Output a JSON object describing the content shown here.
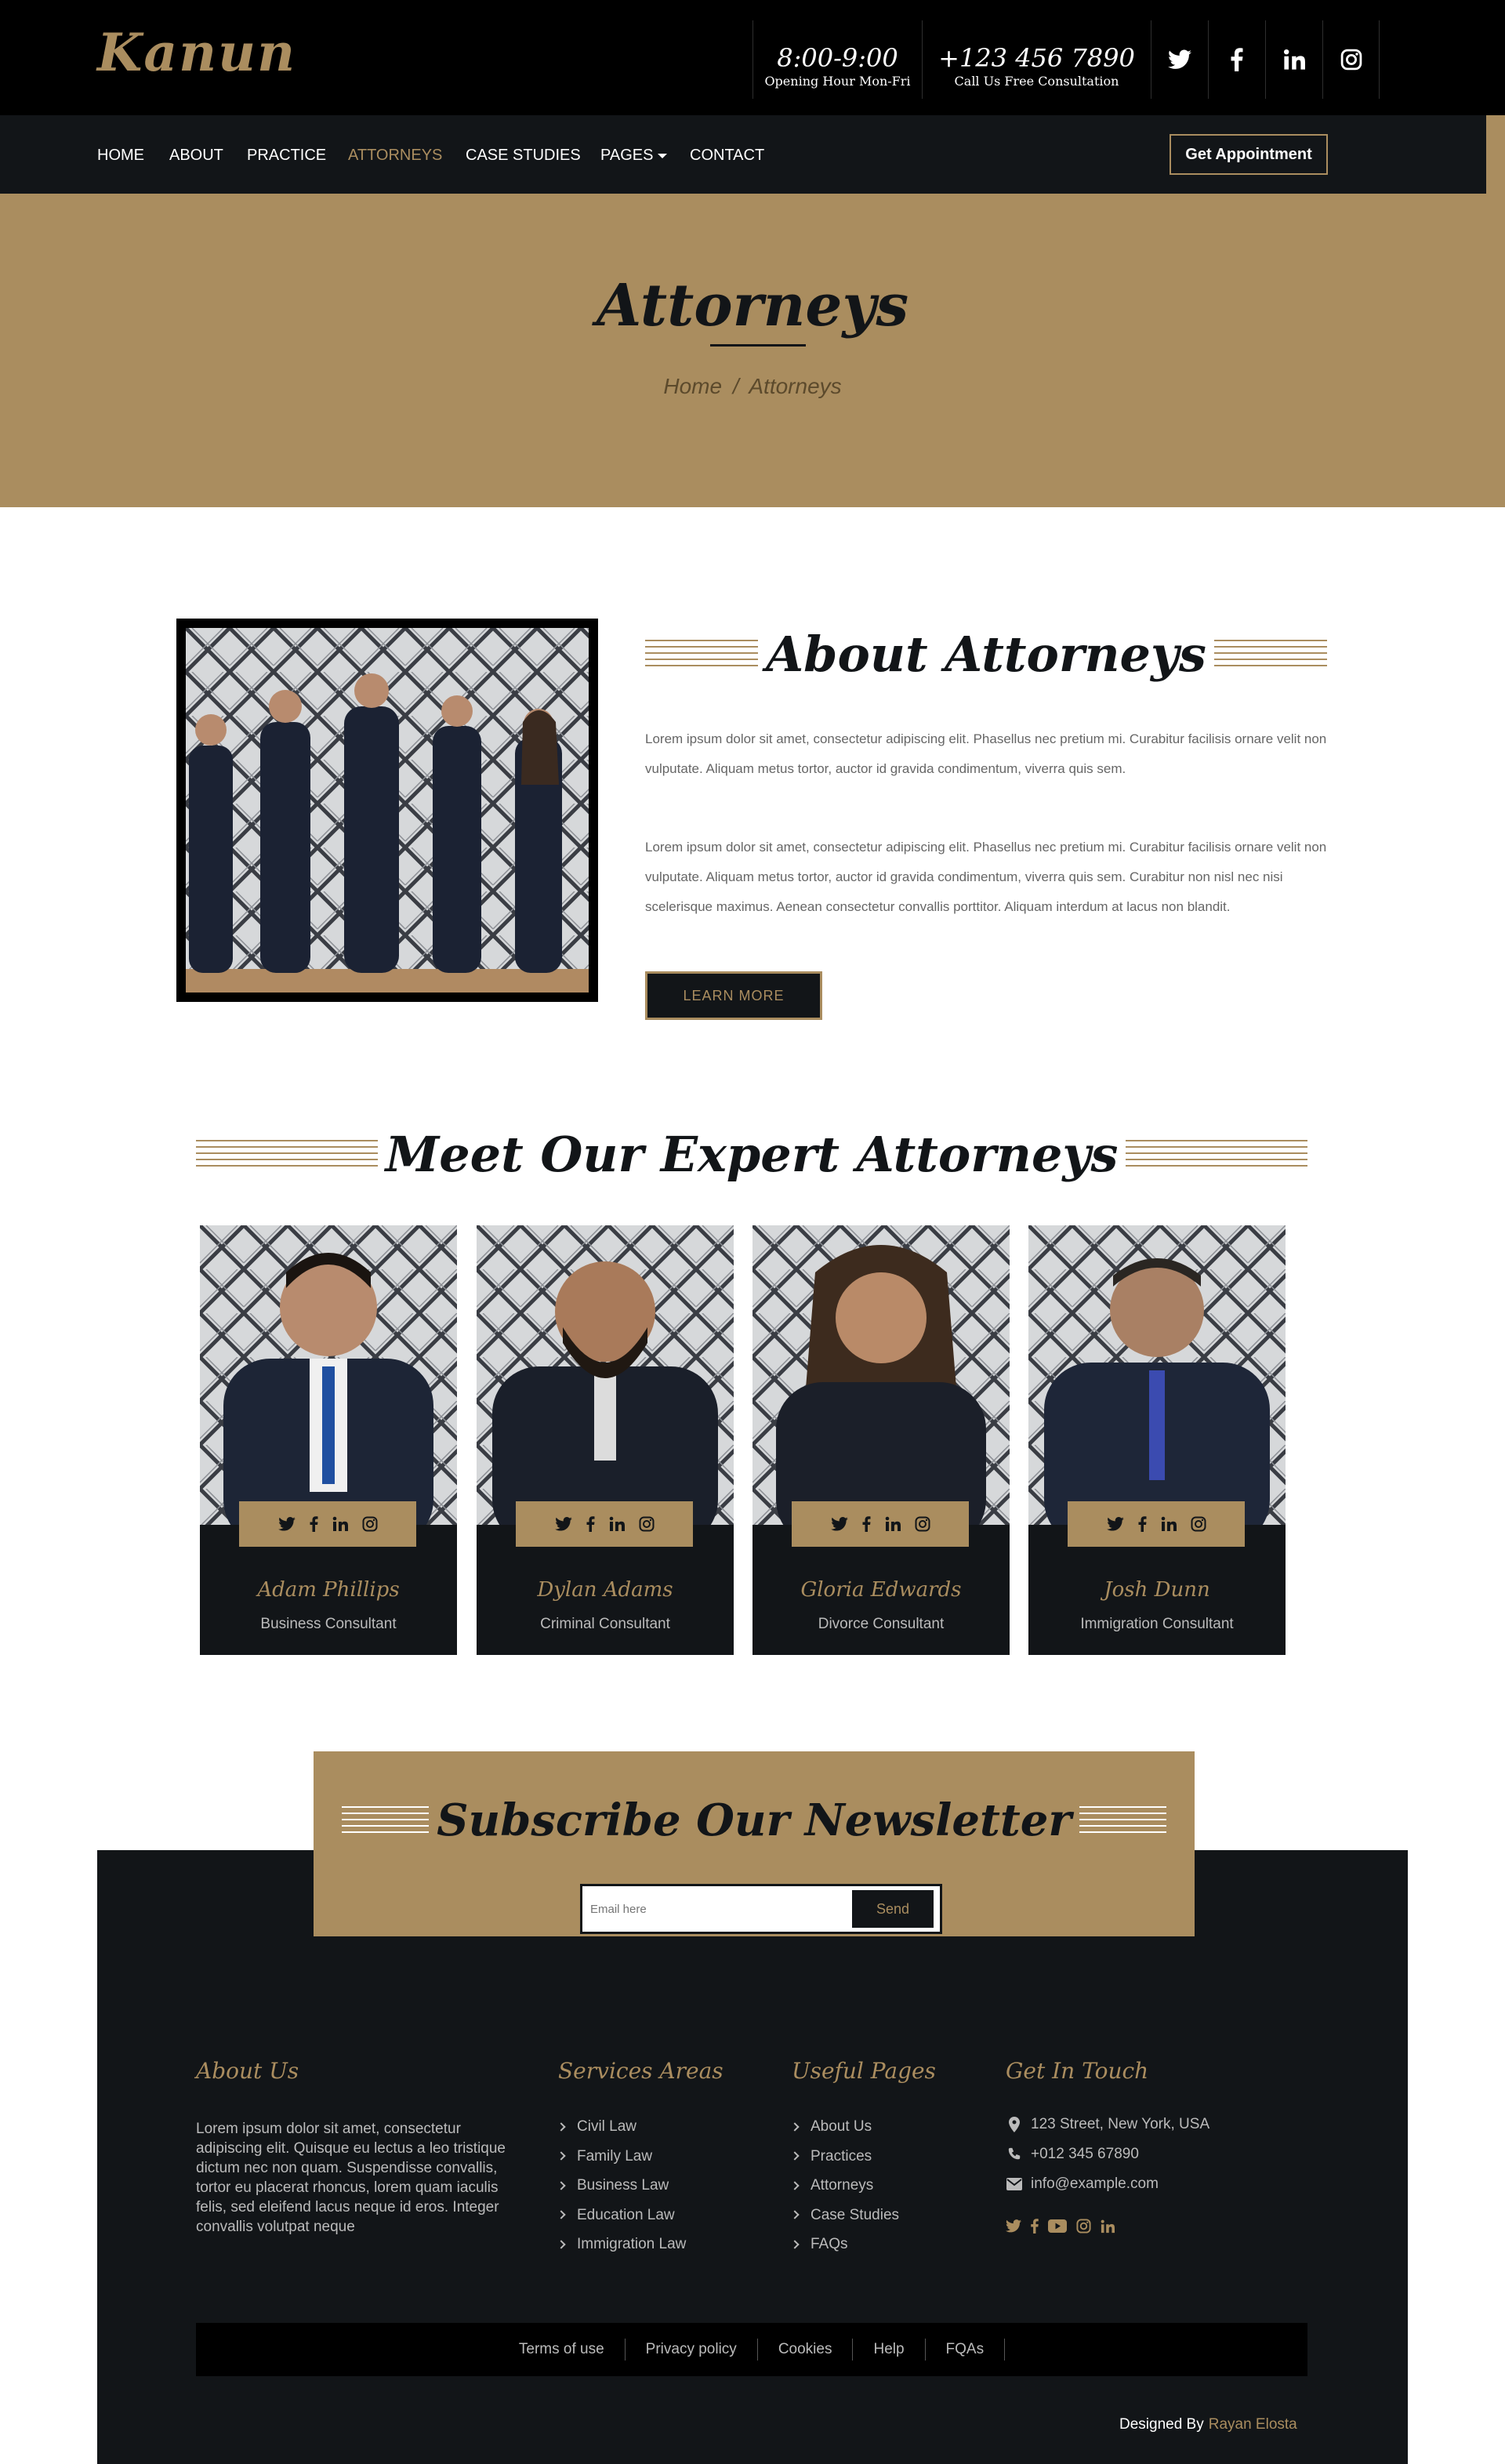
{
  "brand": {
    "logo": "Kanun"
  },
  "topbar": {
    "hours": {
      "value": "8:00-9:00",
      "label": "Opening Hour Mon-Fri"
    },
    "phone": {
      "value": "+123 456 7890",
      "label": "Call Us Free Consultation"
    },
    "social": [
      "twitter-icon",
      "facebook-icon",
      "linkedin-icon",
      "instagram-icon"
    ]
  },
  "nav": {
    "items": [
      "HOME",
      "ABOUT",
      "PRACTICE",
      "ATTORNEYS",
      "CASE STUDIES",
      "PAGES",
      "CONTACT"
    ],
    "active": "ATTORNEYS",
    "cta": "Get Appointment"
  },
  "header": {
    "title": "Attorneys",
    "breadcrumb": [
      "Home",
      "Attorneys"
    ],
    "separator": "/"
  },
  "about": {
    "title": "About Attorneys",
    "paragraphs": [
      "Lorem ipsum dolor sit amet, consectetur adipiscing elit. Phasellus nec pretium mi. Curabitur facilisis ornare velit non vulputate. Aliquam metus tortor, auctor id gravida condimentum, viverra quis sem.",
      "Lorem ipsum dolor sit amet, consectetur adipiscing elit. Phasellus nec pretium mi. Curabitur facilisis ornare velit non vulputate. Aliquam metus tortor, auctor id gravida condimentum, viverra quis sem. Curabitur non nisl nec nisi scelerisque maximus. Aenean consectetur convallis porttitor. Aliquam interdum at lacus non blandit."
    ],
    "button": "LEARN MORE"
  },
  "team": {
    "title": "Meet Our Expert Attorneys",
    "members": [
      {
        "name": "Adam Phillips",
        "role": "Business Consultant"
      },
      {
        "name": "Dylan Adams",
        "role": "Criminal Consultant"
      },
      {
        "name": "Gloria Edwards",
        "role": "Divorce Consultant"
      },
      {
        "name": "Josh Dunn",
        "role": "Immigration Consultant"
      }
    ]
  },
  "newsletter": {
    "title": "Subscribe Our Newsletter",
    "placeholder": "Email here",
    "button": "Send"
  },
  "footer": {
    "about": {
      "title": "About Us",
      "text": "Lorem ipsum dolor sit amet, consectetur adipiscing elit. Quisque eu lectus a leo tristique dictum nec non quam. Suspendisse convallis, tortor eu placerat rhoncus, lorem quam iaculis felis, sed eleifend lacus neque id eros. Integer convallis volutpat neque"
    },
    "services": {
      "title": "Services Areas",
      "items": [
        "Civil Law",
        "Family Law",
        "Business Law",
        "Education Law",
        "Immigration Law"
      ]
    },
    "pages": {
      "title": "Useful Pages",
      "items": [
        "About Us",
        "Practices",
        "Attorneys",
        "Case Studies",
        "FAQs"
      ]
    },
    "contact": {
      "title": "Get In Touch",
      "address": "123 Street, New York, USA",
      "phone": "+012 345 67890",
      "email": "info@example.com"
    },
    "bottom_links": [
      "Terms of use",
      "Privacy policy",
      "Cookies",
      "Help",
      "FQAs"
    ],
    "credit": {
      "label": "Designed By",
      "name": "Rayan Elosta"
    }
  },
  "colors": {
    "accent": "#aa8d5f",
    "dark": "#121518",
    "black": "#000000"
  }
}
